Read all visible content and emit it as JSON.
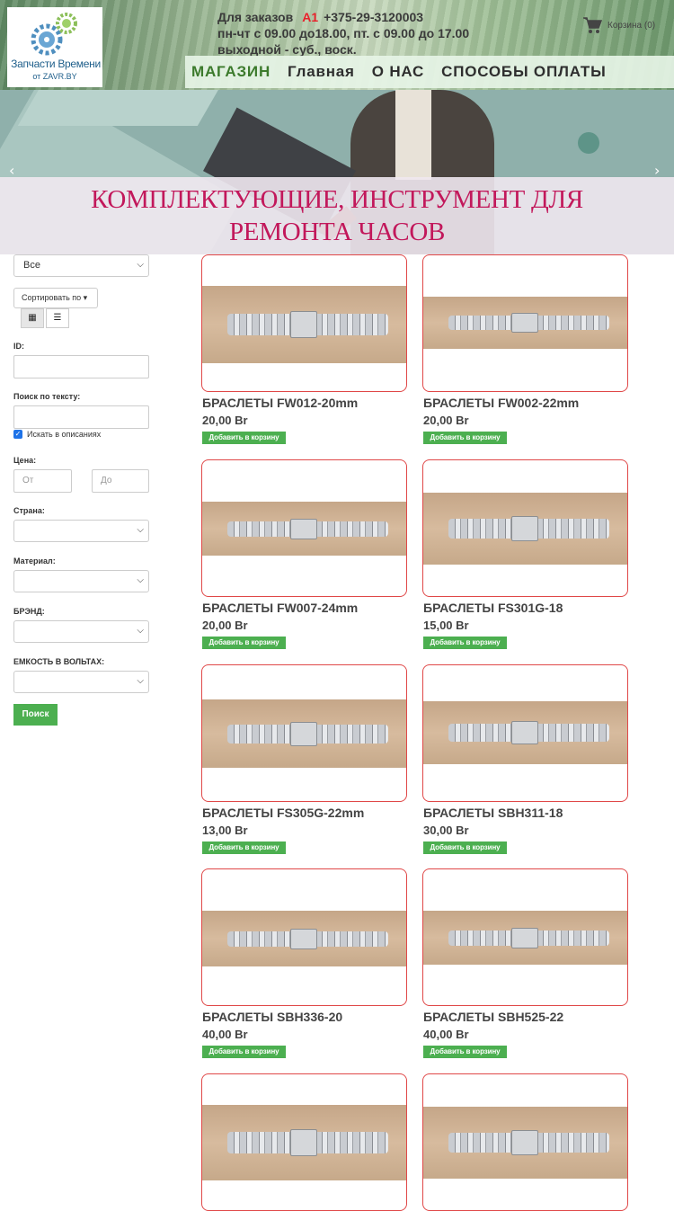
{
  "header": {
    "logo_name": "Запчасти Времени",
    "logo_sub": "от ZAVR.BY",
    "contact_line1_prefix": "Для заказов",
    "contact_operator": "A1",
    "contact_phone": "+375-29-3120003",
    "contact_line2": "пн-чт с 09.00 до18.00, пт. с 09.00 до 17.00",
    "contact_line3": "выходной - суб., воск.",
    "cart_label": "Корзина (0)"
  },
  "nav": {
    "items": [
      {
        "label": "МАГАЗИН"
      },
      {
        "label": "Главная"
      },
      {
        "label": "О НАС"
      },
      {
        "label": "СПОСОБЫ ОПЛАТЫ"
      }
    ]
  },
  "banner": {
    "title": "КОМПЛЕКТУЮЩИЕ, ИНСТРУМЕНТ ДЛЯ РЕМОНТА ЧАСОВ",
    "prev": "‹",
    "next": "›"
  },
  "filters": {
    "category_value": "Все",
    "sort_label": "Сортировать по ▾",
    "id_label": "ID:",
    "text_search_label": "Поиск по тексту:",
    "search_descriptions_label": "Искать в описаниях",
    "price_label": "Цена:",
    "price_from_placeholder": "От",
    "price_to_placeholder": "До",
    "country_label": "Страна:",
    "material_label": "Материал:",
    "brand_label": "БРЭНД:",
    "capacity_label": "ЕМКОСТЬ В ВОЛЬТАХ:",
    "search_button": "Поиск"
  },
  "products": [
    {
      "name": "БРАСЛЕТЫ FW012-20mm",
      "price": "20,00 Br",
      "add": "Добавить в корзину"
    },
    {
      "name": "БРАСЛЕТЫ FW002-22mm",
      "price": "20,00 Br",
      "add": "Добавить в корзину"
    },
    {
      "name": "БРАСЛЕТЫ FW007-24mm",
      "price": "20,00 Br",
      "add": "Добавить в корзину"
    },
    {
      "name": "БРАСЛЕТЫ FS301G-18",
      "price": "15,00 Br",
      "add": "Добавить в корзину"
    },
    {
      "name": "БРАСЛЕТЫ FS305G-22mm",
      "price": "13,00 Br",
      "add": "Добавить в корзину"
    },
    {
      "name": "БРАСЛЕТЫ SBH311-18",
      "price": "30,00 Br",
      "add": "Добавить в корзину"
    },
    {
      "name": "БРАСЛЕТЫ SBH336-20",
      "price": "40,00 Br",
      "add": "Добавить в корзину"
    },
    {
      "name": "БРАСЛЕТЫ SBH525-22",
      "price": "40,00 Br",
      "add": "Добавить в корзину"
    }
  ]
}
